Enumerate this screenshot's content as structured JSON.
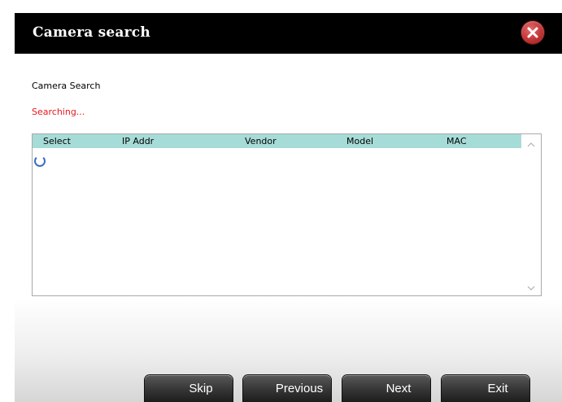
{
  "window": {
    "title": "Camera search",
    "close_icon": "close-icon",
    "close_color": "#c23434"
  },
  "content": {
    "section_label": "Camera Search",
    "status": "Searching...",
    "status_color": "#e8161b"
  },
  "table": {
    "columns": [
      "Select",
      "IP Addr",
      "Vendor",
      "Model",
      "MAC"
    ],
    "header_color": "#a6dcd8",
    "rows": [],
    "loading_icon": "spinner-icon"
  },
  "buttons": {
    "skip": "Skip",
    "previous": "Previous",
    "next": "Next",
    "exit": "Exit"
  }
}
